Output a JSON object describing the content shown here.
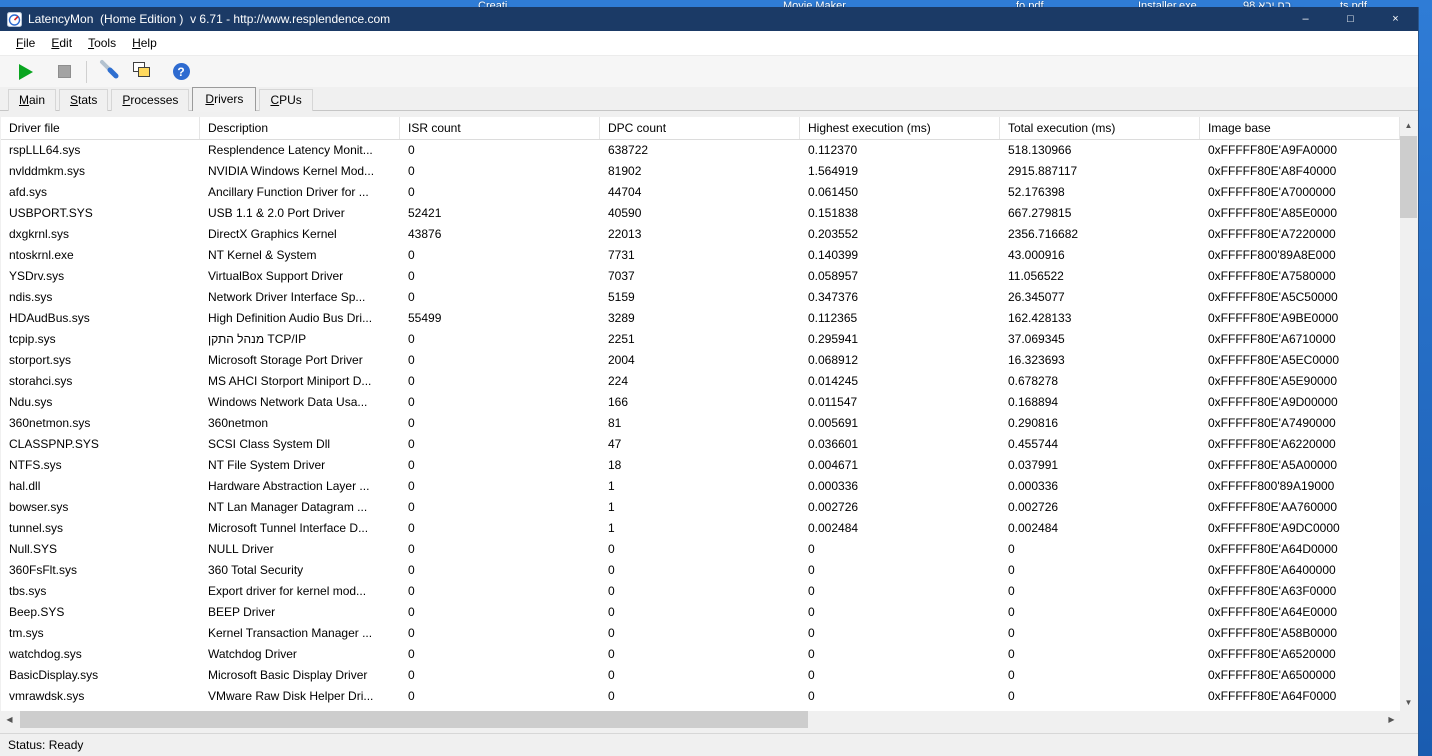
{
  "colors": {
    "titlebar": "#1b3a66",
    "desktop": "#1f6ac4",
    "play_green": "#0aa520",
    "help_blue": "#2e6bd0",
    "scroll_thumb": "#cdcdcd"
  },
  "desktop": {
    "top_labels": [
      "Creati...",
      "Movie Maker",
      "fo.pdf",
      "Installer.exe",
      "בח יבא 98 ...",
      "ts.pdf"
    ]
  },
  "window": {
    "title": "LatencyMon  (Home Edition )  v 6.71 - http://www.resplendence.com",
    "controls": {
      "minimize": "–",
      "maximize": "□",
      "close": "×"
    }
  },
  "menu": {
    "items": [
      "File",
      "Edit",
      "Tools",
      "Help"
    ]
  },
  "toolbar": {
    "buttons": [
      {
        "id": "play-button",
        "icon": "play-icon",
        "enabled": true
      },
      {
        "id": "stop-button",
        "icon": "stop-icon",
        "enabled": false
      },
      {
        "id": "options-button",
        "icon": "wrench-icon",
        "enabled": true
      },
      {
        "id": "copy-report-button",
        "icon": "copy-icon",
        "enabled": true
      },
      {
        "id": "help-button",
        "icon": "question-icon",
        "enabled": true
      }
    ],
    "help_glyph": "?"
  },
  "tabs": [
    {
      "label": "Main",
      "selected": false
    },
    {
      "label": "Stats",
      "selected": false
    },
    {
      "label": "Processes",
      "selected": false
    },
    {
      "label": "Drivers",
      "selected": true
    },
    {
      "label": "CPUs",
      "selected": false
    }
  ],
  "table": {
    "columns": [
      "Driver file",
      "Description",
      "ISR count",
      "DPC count",
      "Highest execution (ms)",
      "Total execution (ms)",
      "Image base"
    ],
    "rows": [
      [
        "rspLLL64.sys",
        "Resplendence Latency Monit...",
        "0",
        "638722",
        "0.112370",
        "518.130966",
        "0xFFFFF80E'A9FA0000"
      ],
      [
        "nvlddmkm.sys",
        "NVIDIA Windows Kernel Mod...",
        "0",
        "81902",
        "1.564919",
        "2915.887117",
        "0xFFFFF80E'A8F40000"
      ],
      [
        "afd.sys",
        "Ancillary Function Driver for ...",
        "0",
        "44704",
        "0.061450",
        "52.176398",
        "0xFFFFF80E'A7000000"
      ],
      [
        "USBPORT.SYS",
        "USB 1.1 & 2.0 Port Driver",
        "52421",
        "40590",
        "0.151838",
        "667.279815",
        "0xFFFFF80E'A85E0000"
      ],
      [
        "dxgkrnl.sys",
        "DirectX Graphics Kernel",
        "43876",
        "22013",
        "0.203552",
        "2356.716682",
        "0xFFFFF80E'A7220000"
      ],
      [
        "ntoskrnl.exe",
        "NT Kernel & System",
        "0",
        "7731",
        "0.140399",
        "43.000916",
        "0xFFFFF800'89A8E000"
      ],
      [
        "YSDrv.sys",
        "VirtualBox Support Driver",
        "0",
        "7037",
        "0.058957",
        "11.056522",
        "0xFFFFF80E'A7580000"
      ],
      [
        "ndis.sys",
        "Network Driver Interface Sp...",
        "0",
        "5159",
        "0.347376",
        "26.345077",
        "0xFFFFF80E'A5C50000"
      ],
      [
        "HDAudBus.sys",
        "High Definition Audio Bus Dri...",
        "55499",
        "3289",
        "0.112365",
        "162.428133",
        "0xFFFFF80E'A9BE0000"
      ],
      [
        "tcpip.sys",
        "מנהל התקן TCP/IP",
        "0",
        "2251",
        "0.295941",
        "37.069345",
        "0xFFFFF80E'A6710000"
      ],
      [
        "storport.sys",
        "Microsoft Storage Port Driver",
        "0",
        "2004",
        "0.068912",
        "16.323693",
        "0xFFFFF80E'A5EC0000"
      ],
      [
        "storahci.sys",
        "MS AHCI Storport Miniport D...",
        "0",
        "224",
        "0.014245",
        "0.678278",
        "0xFFFFF80E'A5E90000"
      ],
      [
        "Ndu.sys",
        "Windows Network Data Usa...",
        "0",
        "166",
        "0.011547",
        "0.168894",
        "0xFFFFF80E'A9D00000"
      ],
      [
        "360netmon.sys",
        "360netmon",
        "0",
        "81",
        "0.005691",
        "0.290816",
        "0xFFFFF80E'A7490000"
      ],
      [
        "CLASSPNP.SYS",
        "SCSI Class System Dll",
        "0",
        "47",
        "0.036601",
        "0.455744",
        "0xFFFFF80E'A6220000"
      ],
      [
        "NTFS.sys",
        "NT File System Driver",
        "0",
        "18",
        "0.004671",
        "0.037991",
        "0xFFFFF80E'A5A00000"
      ],
      [
        "hal.dll",
        "Hardware Abstraction Layer ...",
        "0",
        "1",
        "0.000336",
        "0.000336",
        "0xFFFFF800'89A19000"
      ],
      [
        "bowser.sys",
        "NT Lan Manager Datagram ...",
        "0",
        "1",
        "0.002726",
        "0.002726",
        "0xFFFFF80E'AA760000"
      ],
      [
        "tunnel.sys",
        "Microsoft Tunnel Interface D...",
        "0",
        "1",
        "0.002484",
        "0.002484",
        "0xFFFFF80E'A9DC0000"
      ],
      [
        "Null.SYS",
        "NULL Driver",
        "0",
        "0",
        "0",
        "0",
        "0xFFFFF80E'A64D0000"
      ],
      [
        "360FsFlt.sys",
        "360 Total Security",
        "0",
        "0",
        "0",
        "0",
        "0xFFFFF80E'A6400000"
      ],
      [
        "tbs.sys",
        "Export driver for kernel mod...",
        "0",
        "0",
        "0",
        "0",
        "0xFFFFF80E'A63F0000"
      ],
      [
        "Beep.SYS",
        "BEEP Driver",
        "0",
        "0",
        "0",
        "0",
        "0xFFFFF80E'A64E0000"
      ],
      [
        "tm.sys",
        "Kernel Transaction Manager ...",
        "0",
        "0",
        "0",
        "0",
        "0xFFFFF80E'A58B0000"
      ],
      [
        "watchdog.sys",
        "Watchdog Driver",
        "0",
        "0",
        "0",
        "0",
        "0xFFFFF80E'A6520000"
      ],
      [
        "BasicDisplay.sys",
        "Microsoft Basic Display Driver",
        "0",
        "0",
        "0",
        "0",
        "0xFFFFF80E'A6500000"
      ],
      [
        "vmrawdsk.sys",
        "VMware Raw Disk Helper Dri...",
        "0",
        "0",
        "0",
        "0",
        "0xFFFFF80E'A64F0000"
      ]
    ]
  },
  "scrollbar": {
    "up": "▲",
    "down": "▼",
    "left": "◀",
    "right": "▶"
  },
  "status_bar": {
    "text": "Status: Ready"
  }
}
